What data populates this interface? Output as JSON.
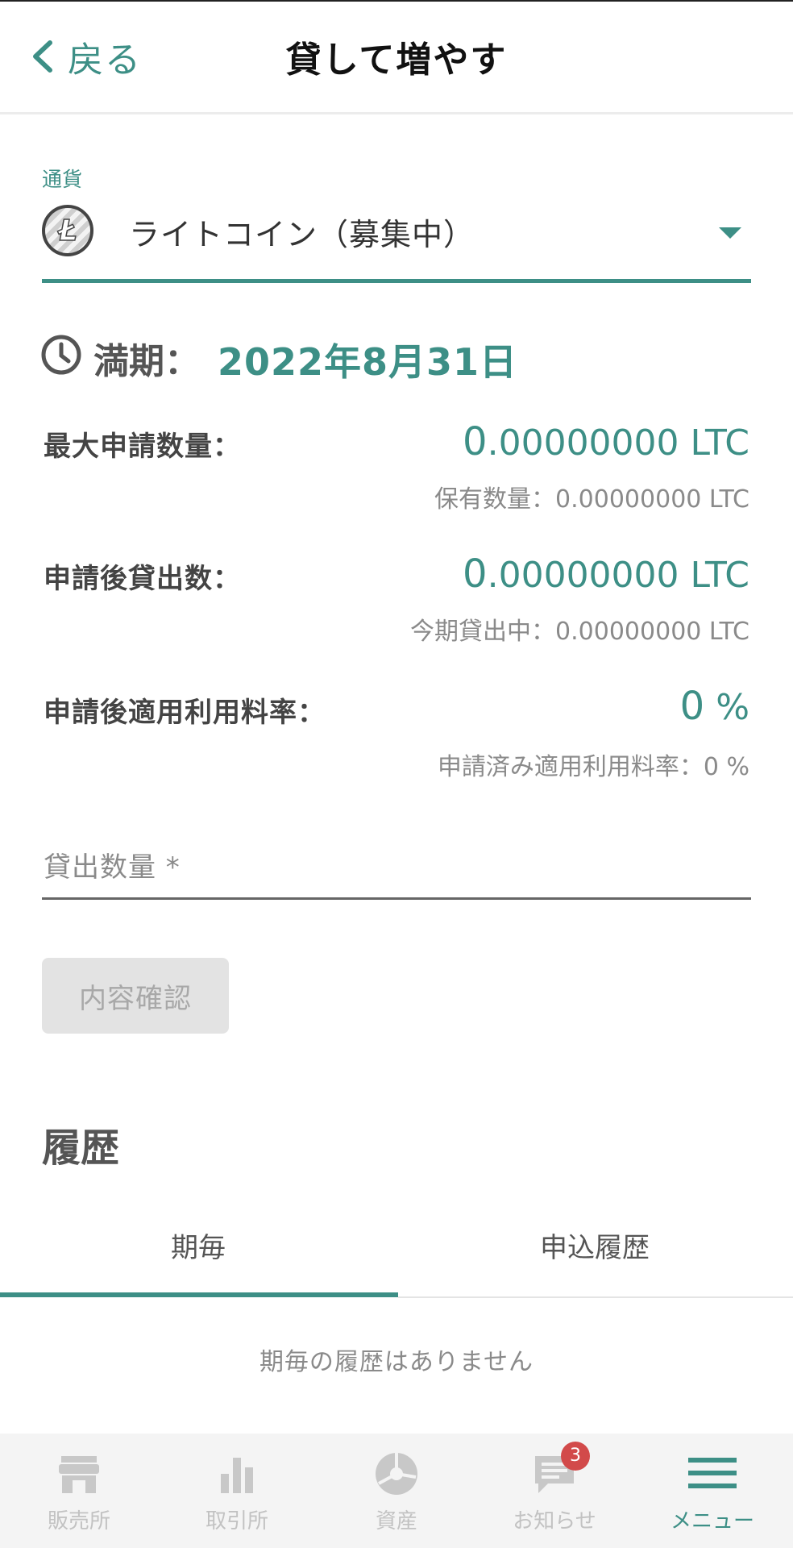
{
  "header": {
    "back_label": "戻る",
    "title": "貸して増やす"
  },
  "currency": {
    "label": "通貨",
    "selected": "ライトコイン（募集中）",
    "icon": "litecoin-icon"
  },
  "maturity": {
    "label": "満期：",
    "value": "2022年8月31日"
  },
  "rows": [
    {
      "label": "最大申請数量：",
      "value_int": "0",
      "value_rest": ".00000000 LTC",
      "sub": "保有数量：0.00000000 LTC"
    },
    {
      "label": "申請後貸出数：",
      "value_int": "0",
      "value_rest": ".00000000 LTC",
      "sub": "今期貸出中：0.00000000 LTC"
    },
    {
      "label": "申請後適用利用料率：",
      "value_int": "0",
      "value_rest": " %",
      "sub": "申請済み適用利用料率：0 %"
    }
  ],
  "amount": {
    "label": "貸出数量 *",
    "value": ""
  },
  "confirm_button": "内容確認",
  "history": {
    "title": "履歴",
    "tabs": [
      "期毎",
      "申込履歴"
    ],
    "active_tab": 0,
    "empty_message": "期毎の履歴はありません"
  },
  "nav": {
    "items": [
      {
        "label": "販売所",
        "icon": "store-icon"
      },
      {
        "label": "取引所",
        "icon": "bar-chart-icon"
      },
      {
        "label": "資産",
        "icon": "pie-chart-icon"
      },
      {
        "label": "お知らせ",
        "icon": "message-icon",
        "badge": "3"
      },
      {
        "label": "メニュー",
        "icon": "hamburger-menu-icon",
        "active": true
      }
    ]
  },
  "colors": {
    "accent": "#3d8f86",
    "badge": "#d24a4a",
    "muted": "#8a8a8a"
  }
}
